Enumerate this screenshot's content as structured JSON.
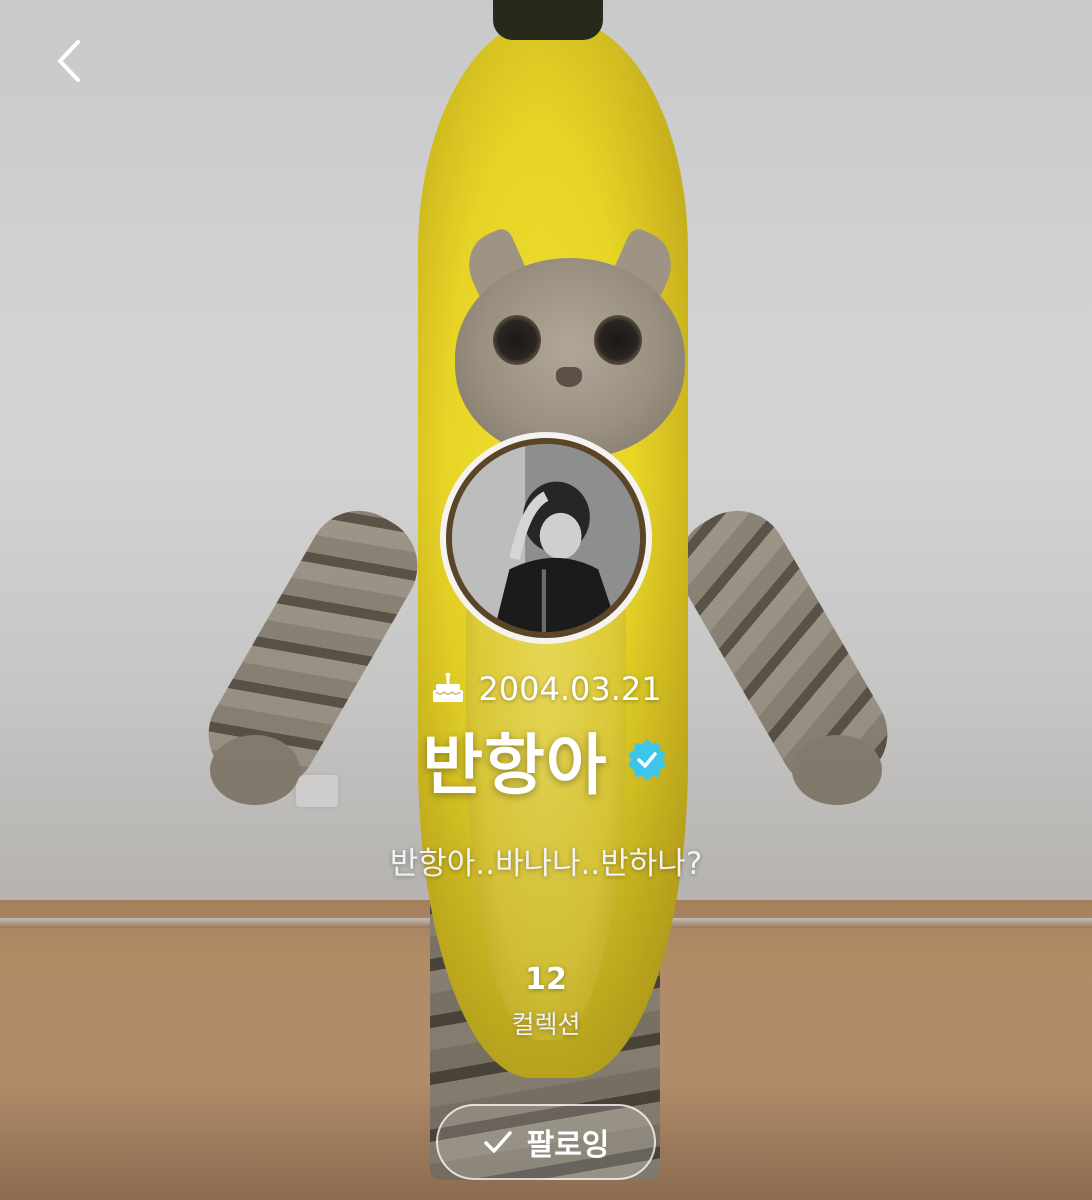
{
  "profile": {
    "birthday": "2004.03.21",
    "name": "반항아",
    "bio": "반항아..바나나..반하나?",
    "collections_count": "12",
    "collections_label": "컬렉션",
    "follow_label": "팔로잉",
    "verified": true
  },
  "icons": {
    "back": "chevron-left-icon",
    "birthday": "cake-icon",
    "verified": "verified-badge-icon",
    "follow": "checkmark-icon"
  },
  "colors": {
    "verified_badge": "#3ec6ea",
    "avatar_ring": "#5a4527"
  }
}
